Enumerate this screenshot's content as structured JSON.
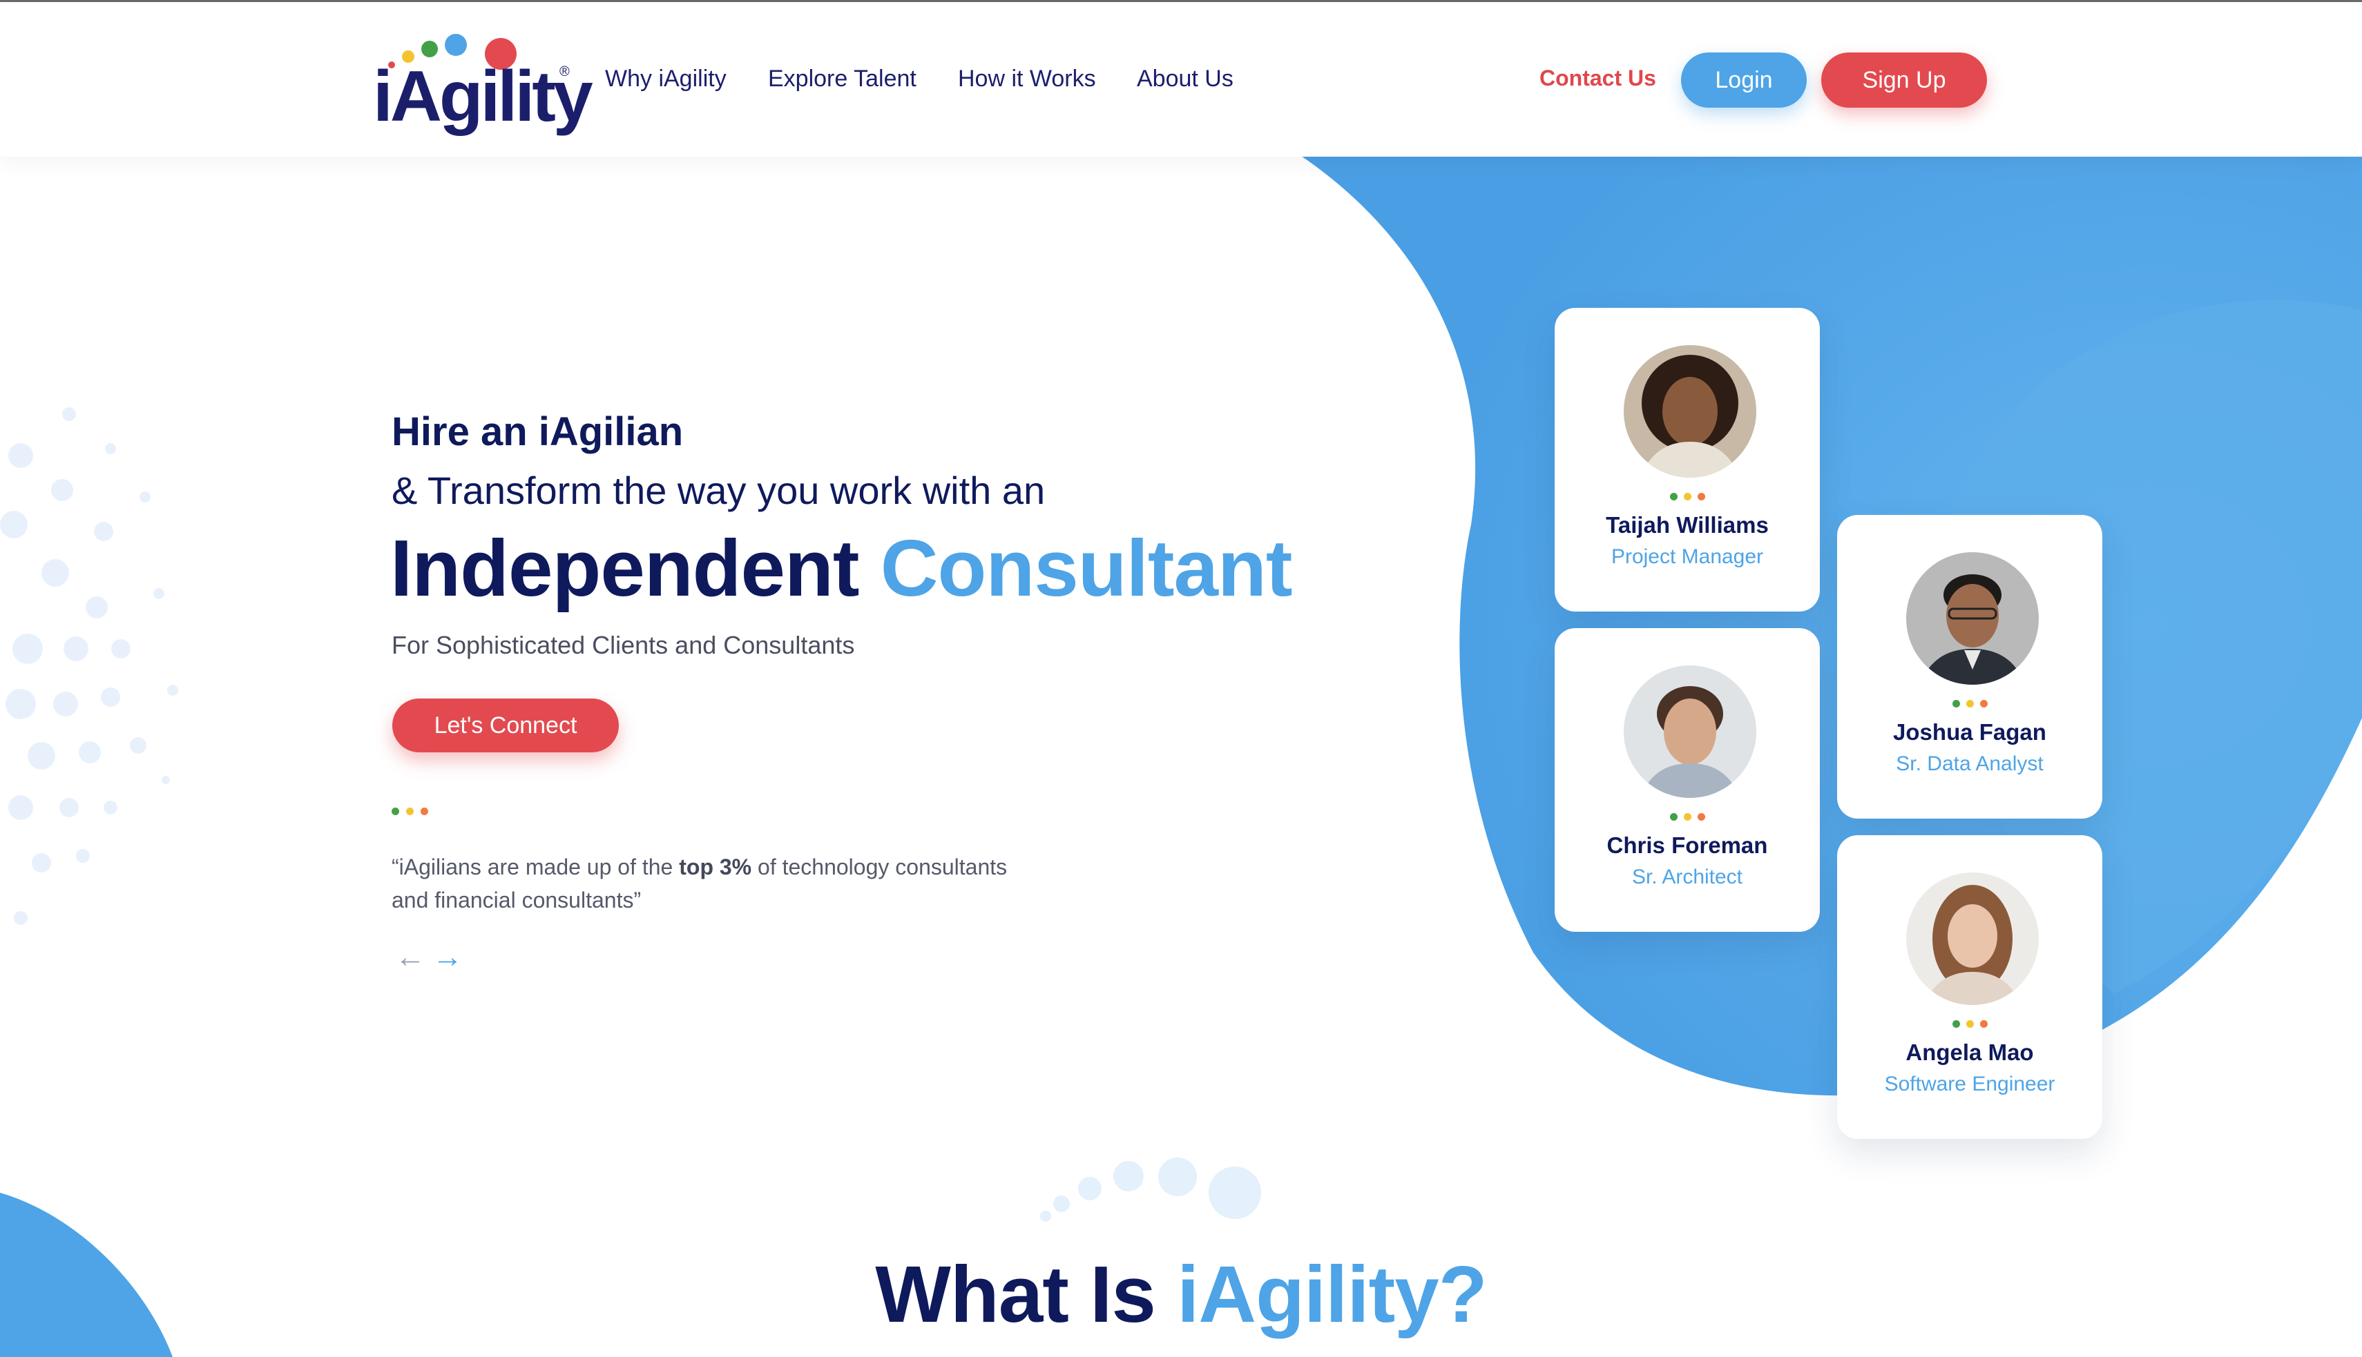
{
  "header": {
    "logo_text": "iAgility",
    "nav": [
      "Why iAgility",
      "Explore Talent",
      "How it Works",
      "About Us"
    ],
    "contact": "Contact Us",
    "login": "Login",
    "signup": "Sign Up"
  },
  "hero": {
    "hire": "Hire an iAgilian",
    "transform": "& Transform the way you work with an",
    "headline_dark": "Independent",
    "headline_accent": "Consultant",
    "subline": "For Sophisticated Clients and Consultants",
    "cta": "Let's Connect",
    "quote_before": "“iAgilians are made up of the",
    "quote_bold": "top 3%",
    "quote_after": "of technology consultants and financial consultants”",
    "prev_arrow": "←",
    "next_arrow": "→"
  },
  "consultants": [
    {
      "name": "Taijah Williams",
      "role": "Project Manager"
    },
    {
      "name": "Joshua Fagan",
      "role": "Sr. Data Analyst"
    },
    {
      "name": "Chris Foreman",
      "role": "Sr. Architect"
    },
    {
      "name": "Angela Mao",
      "role": "Software Engineer"
    }
  ],
  "section": {
    "what_dark": "What Is",
    "what_accent": "iAgility?"
  },
  "colors": {
    "navy": "#0f1a5c",
    "blue": "#4ea4e6",
    "red": "#e24a4f",
    "green": "#43a047",
    "yellow": "#f4c430",
    "orange": "#f07b3f"
  }
}
